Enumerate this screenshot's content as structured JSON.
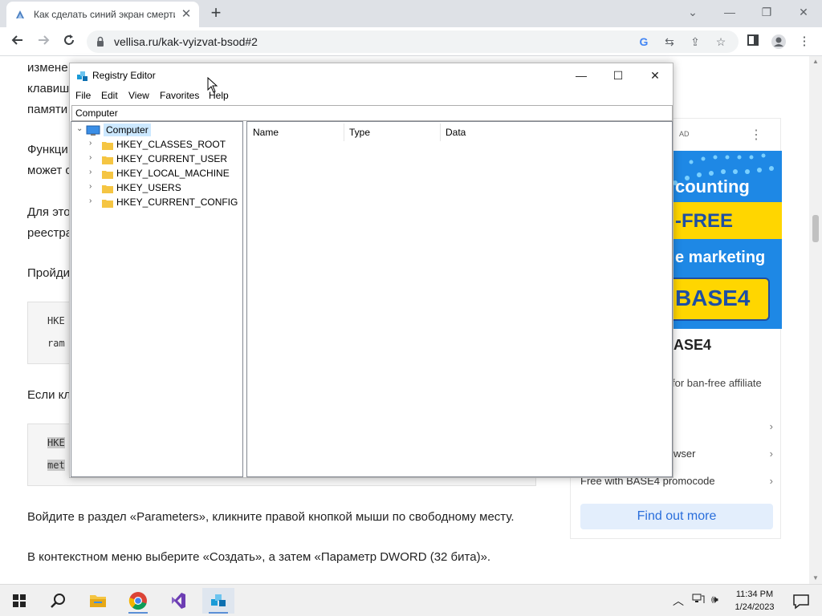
{
  "browser": {
    "tab_title": "Как сделать синий экран смерти",
    "tab_close": "✕",
    "new_tab": "+",
    "url": "vellisa.ru/kak-vyizvat-bsod#2",
    "window_controls": [
      "⌄",
      "—",
      "❐",
      "✕"
    ]
  },
  "article": {
    "lines": [
      "измене",
      "клавиш",
      "памяти",
      "Функци",
      "может с",
      "Для это",
      "реестра",
      "Пройди",
      "Если кл"
    ],
    "code1": [
      "HKE",
      "ram"
    ],
    "code2": [
      "HKE",
      "met"
    ],
    "para_parameters": "Войдите в раздел «Parameters», кликните правой кнопкой мыши по свободному месту.",
    "para_context": "В контекстном меню выберите «Создать», а затем «Параметр DWORD (32 бита)»."
  },
  "ad": {
    "tag": "AD",
    "dots": "⋮",
    "banner_lines": [
      "counting",
      "-FREE",
      "e marketing",
      "BASE4"
    ],
    "headline": "ASE4",
    "sub": "for ban-free affiliate",
    "rows": [
      "",
      "wser",
      "Free with BASE4 promocode"
    ],
    "chevron": "›",
    "cta": "Find out more"
  },
  "regedit": {
    "title": "Registry Editor",
    "menu": [
      "File",
      "Edit",
      "View",
      "Favorites",
      "Help"
    ],
    "address": "Computer",
    "tree_root": "Computer",
    "hives": [
      "HKEY_CLASSES_ROOT",
      "HKEY_CURRENT_USER",
      "HKEY_LOCAL_MACHINE",
      "HKEY_USERS",
      "HKEY_CURRENT_CONFIG"
    ],
    "columns": [
      "Name",
      "Type",
      "Data"
    ],
    "controls": [
      "—",
      "☐",
      "✕"
    ]
  },
  "taskbar": {
    "time": "11:34 PM",
    "date": "1/24/2023"
  }
}
